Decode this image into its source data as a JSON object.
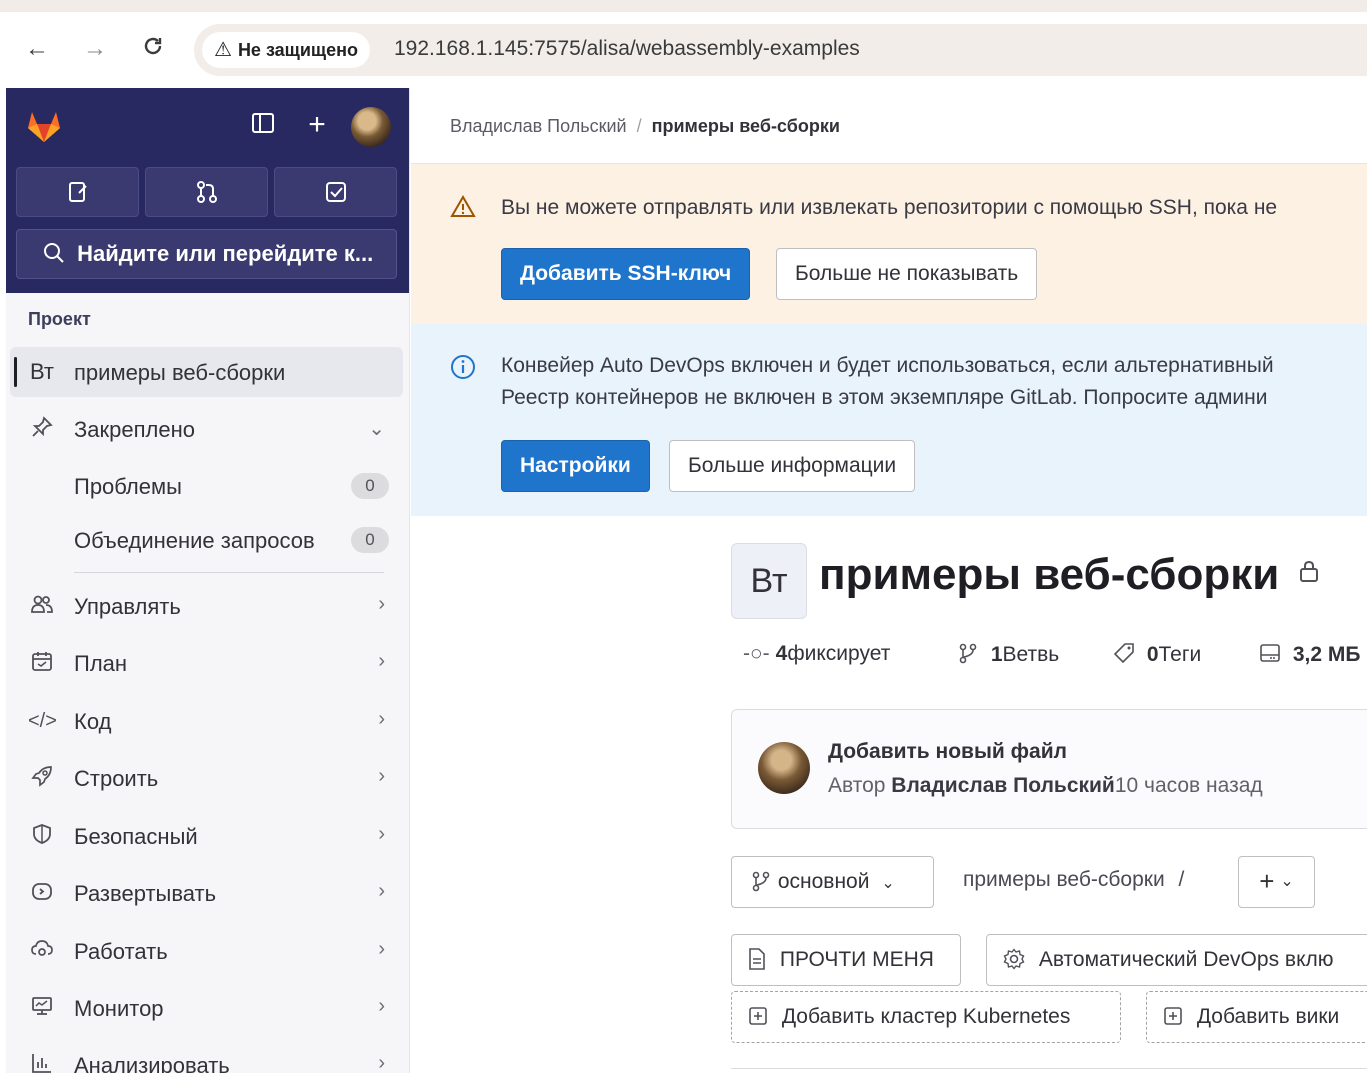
{
  "browser": {
    "back_icon": "←",
    "forward_icon": "→",
    "reload_icon": "C",
    "security_label": "Не защищено",
    "url": "192.168.1.145:7575/alisa/webassembly-examples"
  },
  "sidebar": {
    "search_label": "Найдите или перейдите к...",
    "section_title": "Проект",
    "project": {
      "avatar": "Вт",
      "label": "примеры веб-сборки"
    },
    "pinned": {
      "label": "Закреплено"
    },
    "pinned_items": [
      {
        "label": "Проблемы",
        "count": "0"
      },
      {
        "label": "Объединение запросов",
        "count": "0"
      }
    ],
    "items": [
      {
        "label": "Управлять"
      },
      {
        "label": "План"
      },
      {
        "label": "Код"
      },
      {
        "label": "Строить"
      },
      {
        "label": "Безопасный"
      },
      {
        "label": "Развертывать"
      },
      {
        "label": "Работать"
      },
      {
        "label": "Монитор"
      },
      {
        "label": "Анализировать"
      }
    ]
  },
  "breadcrumb": {
    "parent": "Владислав Польский",
    "separator": "/",
    "current": "примеры веб-сборки"
  },
  "ssh_alert": {
    "text": "Вы не можете отправлять или извлекать репозитории с помощью SSH, пока не",
    "primary_button": "Добавить SSH-ключ",
    "secondary_button": "Больше не показывать"
  },
  "devops_alert": {
    "line1": "Конвейер Auto DevOps включен и будет использоваться, если альтернативный",
    "line2": "Реестр контейнеров не включен в этом экземпляре GitLab. Попросите админи",
    "primary_button": "Настройки",
    "secondary_button": "Больше информации"
  },
  "project": {
    "avatar": "Вт",
    "title": "примеры веб-сборки",
    "stats": {
      "commits_value": "4",
      "commits_label": "фиксирует",
      "branches_value": "1",
      "branches_label": "Ветвь",
      "tags_value": "0",
      "tags_label": "Теги",
      "size": "3,2 МБ"
    }
  },
  "last_commit": {
    "title": "Добавить новый файл",
    "author_prefix": "Автор",
    "author": "Владислав Польский",
    "time": "10 часов назад"
  },
  "repo": {
    "branch": "основной",
    "path": "примеры веб-сборки",
    "path_sep": "/",
    "plus": "+"
  },
  "shortcuts": {
    "readme": "ПРОЧТИ МЕНЯ",
    "autodevops": "Автоматический DevOps вклю",
    "add_k8s": "Добавить кластер Kubernetes",
    "add_wiki": "Добавить вики"
  },
  "colors": {
    "sidebar_header": "#292961",
    "primary": "#1f75cb",
    "warning_bg": "#fcf1e3",
    "info_bg": "#e9f3fc"
  }
}
